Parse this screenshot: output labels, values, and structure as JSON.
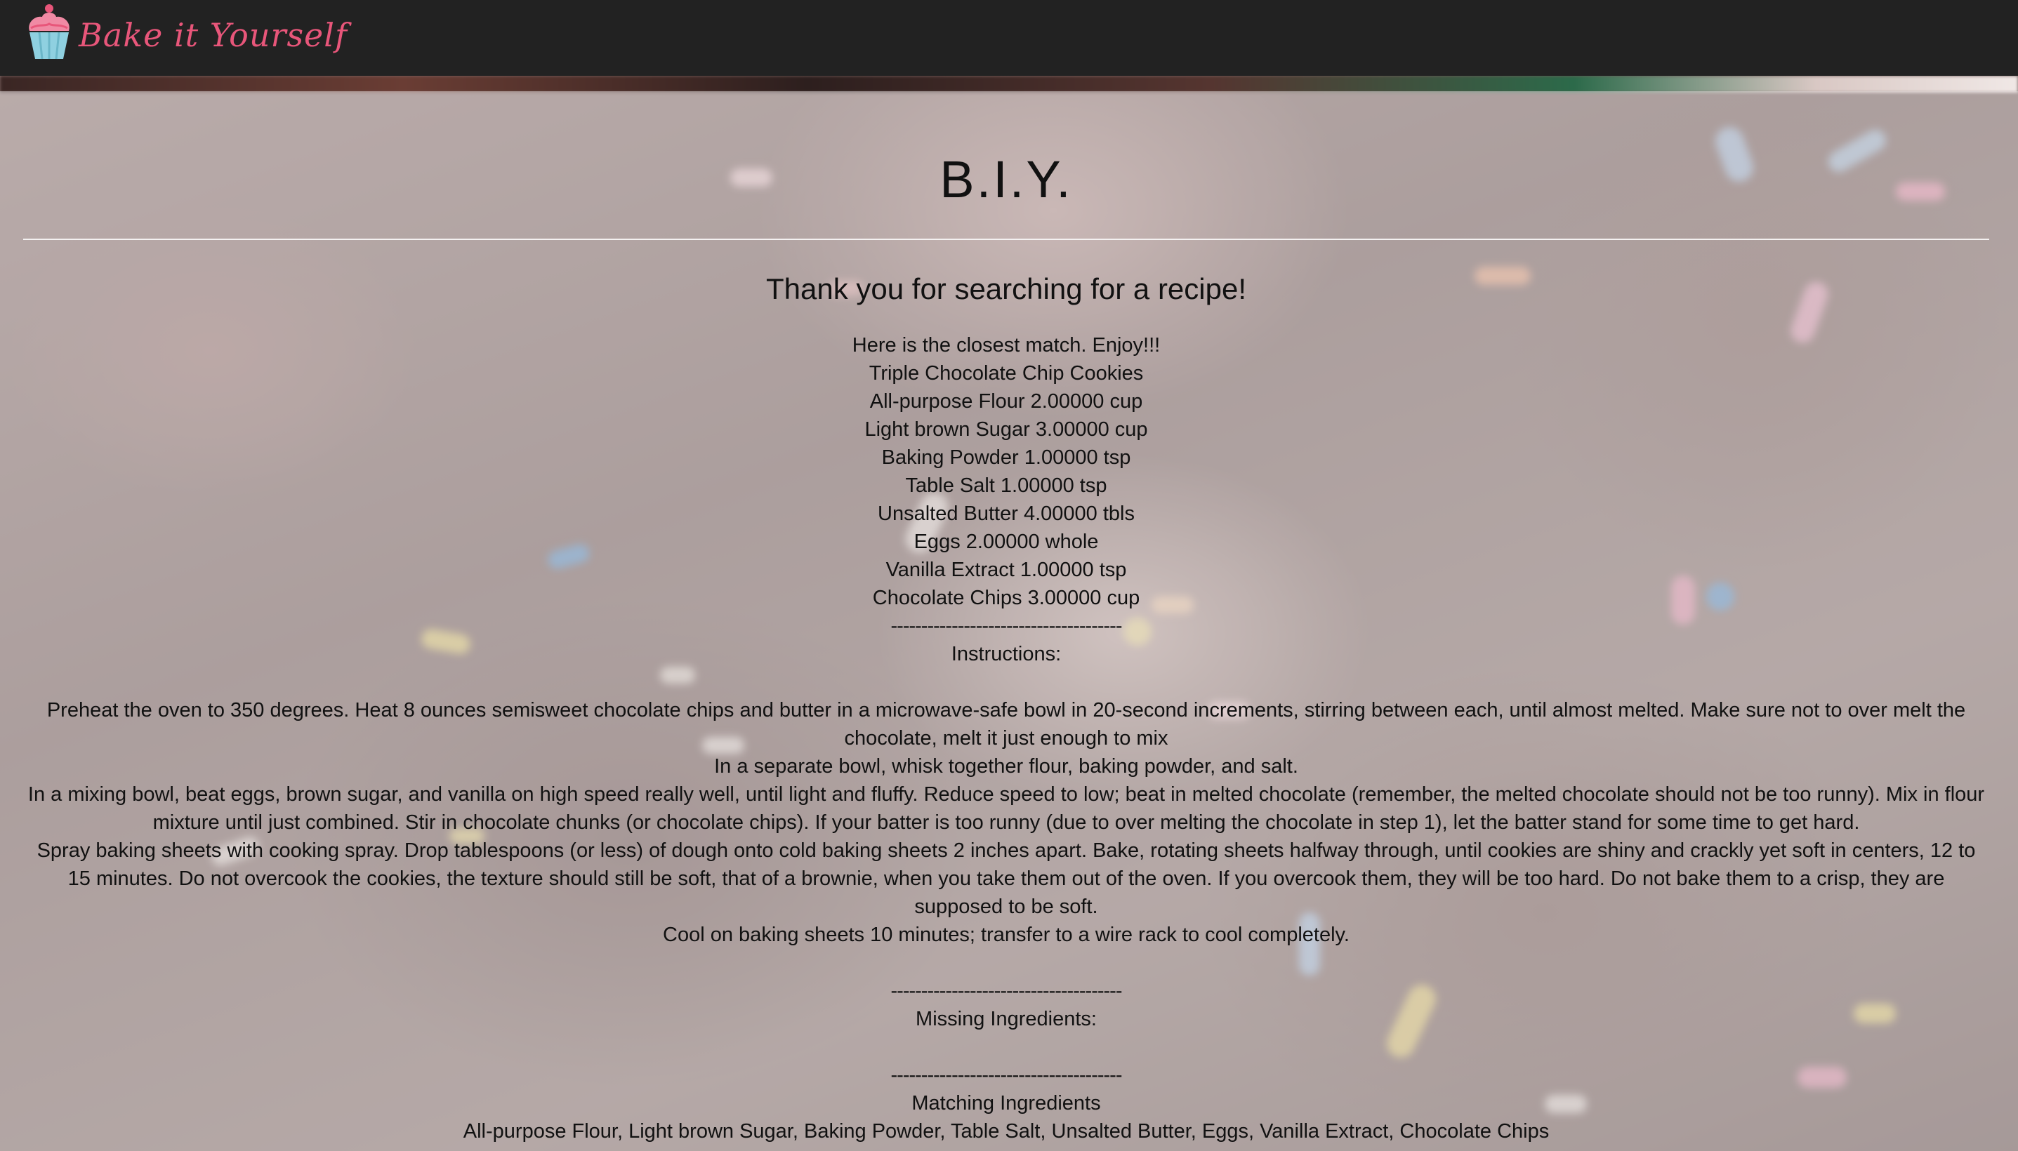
{
  "navbar": {
    "brand_name": "Bake it Yourself",
    "logo_icon": "cupcake-icon",
    "colors": {
      "background": "#222222",
      "brand": "#e8567a"
    }
  },
  "header": {
    "title": "B.I.Y.",
    "subtitle": "Thank you for searching for a recipe!"
  },
  "recipe": {
    "intro": "Here is the closest match. Enjoy!!!",
    "name": "Triple Chocolate Chip Cookies",
    "ingredients": [
      "All-purpose Flour 2.00000 cup",
      "Light brown Sugar 3.00000 cup",
      "Baking Powder 1.00000 tsp",
      "Table Salt 1.00000 tsp",
      "Unsalted Butter 4.00000 tbls",
      "Eggs 2.00000 whole",
      "Vanilla Extract 1.00000 tsp",
      "Chocolate Chips 3.00000 cup"
    ],
    "separator": "--------------------------------------",
    "instructions_label": "Instructions:",
    "instructions": [
      "Preheat the oven to 350 degrees. Heat 8 ounces semisweet chocolate chips and butter in a microwave-safe bowl in 20-second increments, stirring between each, until almost melted. Make sure not to over melt the chocolate, melt it just enough to mix",
      "In a separate bowl, whisk together flour, baking powder, and salt.",
      "In a mixing bowl, beat eggs, brown sugar, and vanilla on high speed really well, until light and fluffy. Reduce speed to low; beat in melted chocolate (remember, the melted chocolate should not be too runny). Mix in flour mixture until just combined. Stir in chocolate chunks (or chocolate chips). If your batter is too runny (due to over melting the chocolate in step 1), let the batter stand for some time to get hard.",
      "Spray baking sheets with cooking spray. Drop tablespoons (or less) of dough onto cold baking sheets 2 inches apart. Bake, rotating sheets halfway through, until cookies are shiny and crackly yet soft in centers, 12 to 15 minutes. Do not overcook the cookies, the texture should still be soft, that of a brownie, when you take them out of the oven. If you overcook them, they will be too hard. Do not bake them to a crisp, they are supposed to be soft.",
      "Cool on baking sheets 10 minutes; transfer to a wire rack to cool completely."
    ],
    "missing_label": "Missing Ingredients:",
    "matching_label": "Matching Ingredients",
    "matching_list": "All-purpose Flour, Light brown Sugar, Baking Powder, Table Salt, Unsalted Butter, Eggs, Vanilla Extract, Chocolate Chips"
  }
}
